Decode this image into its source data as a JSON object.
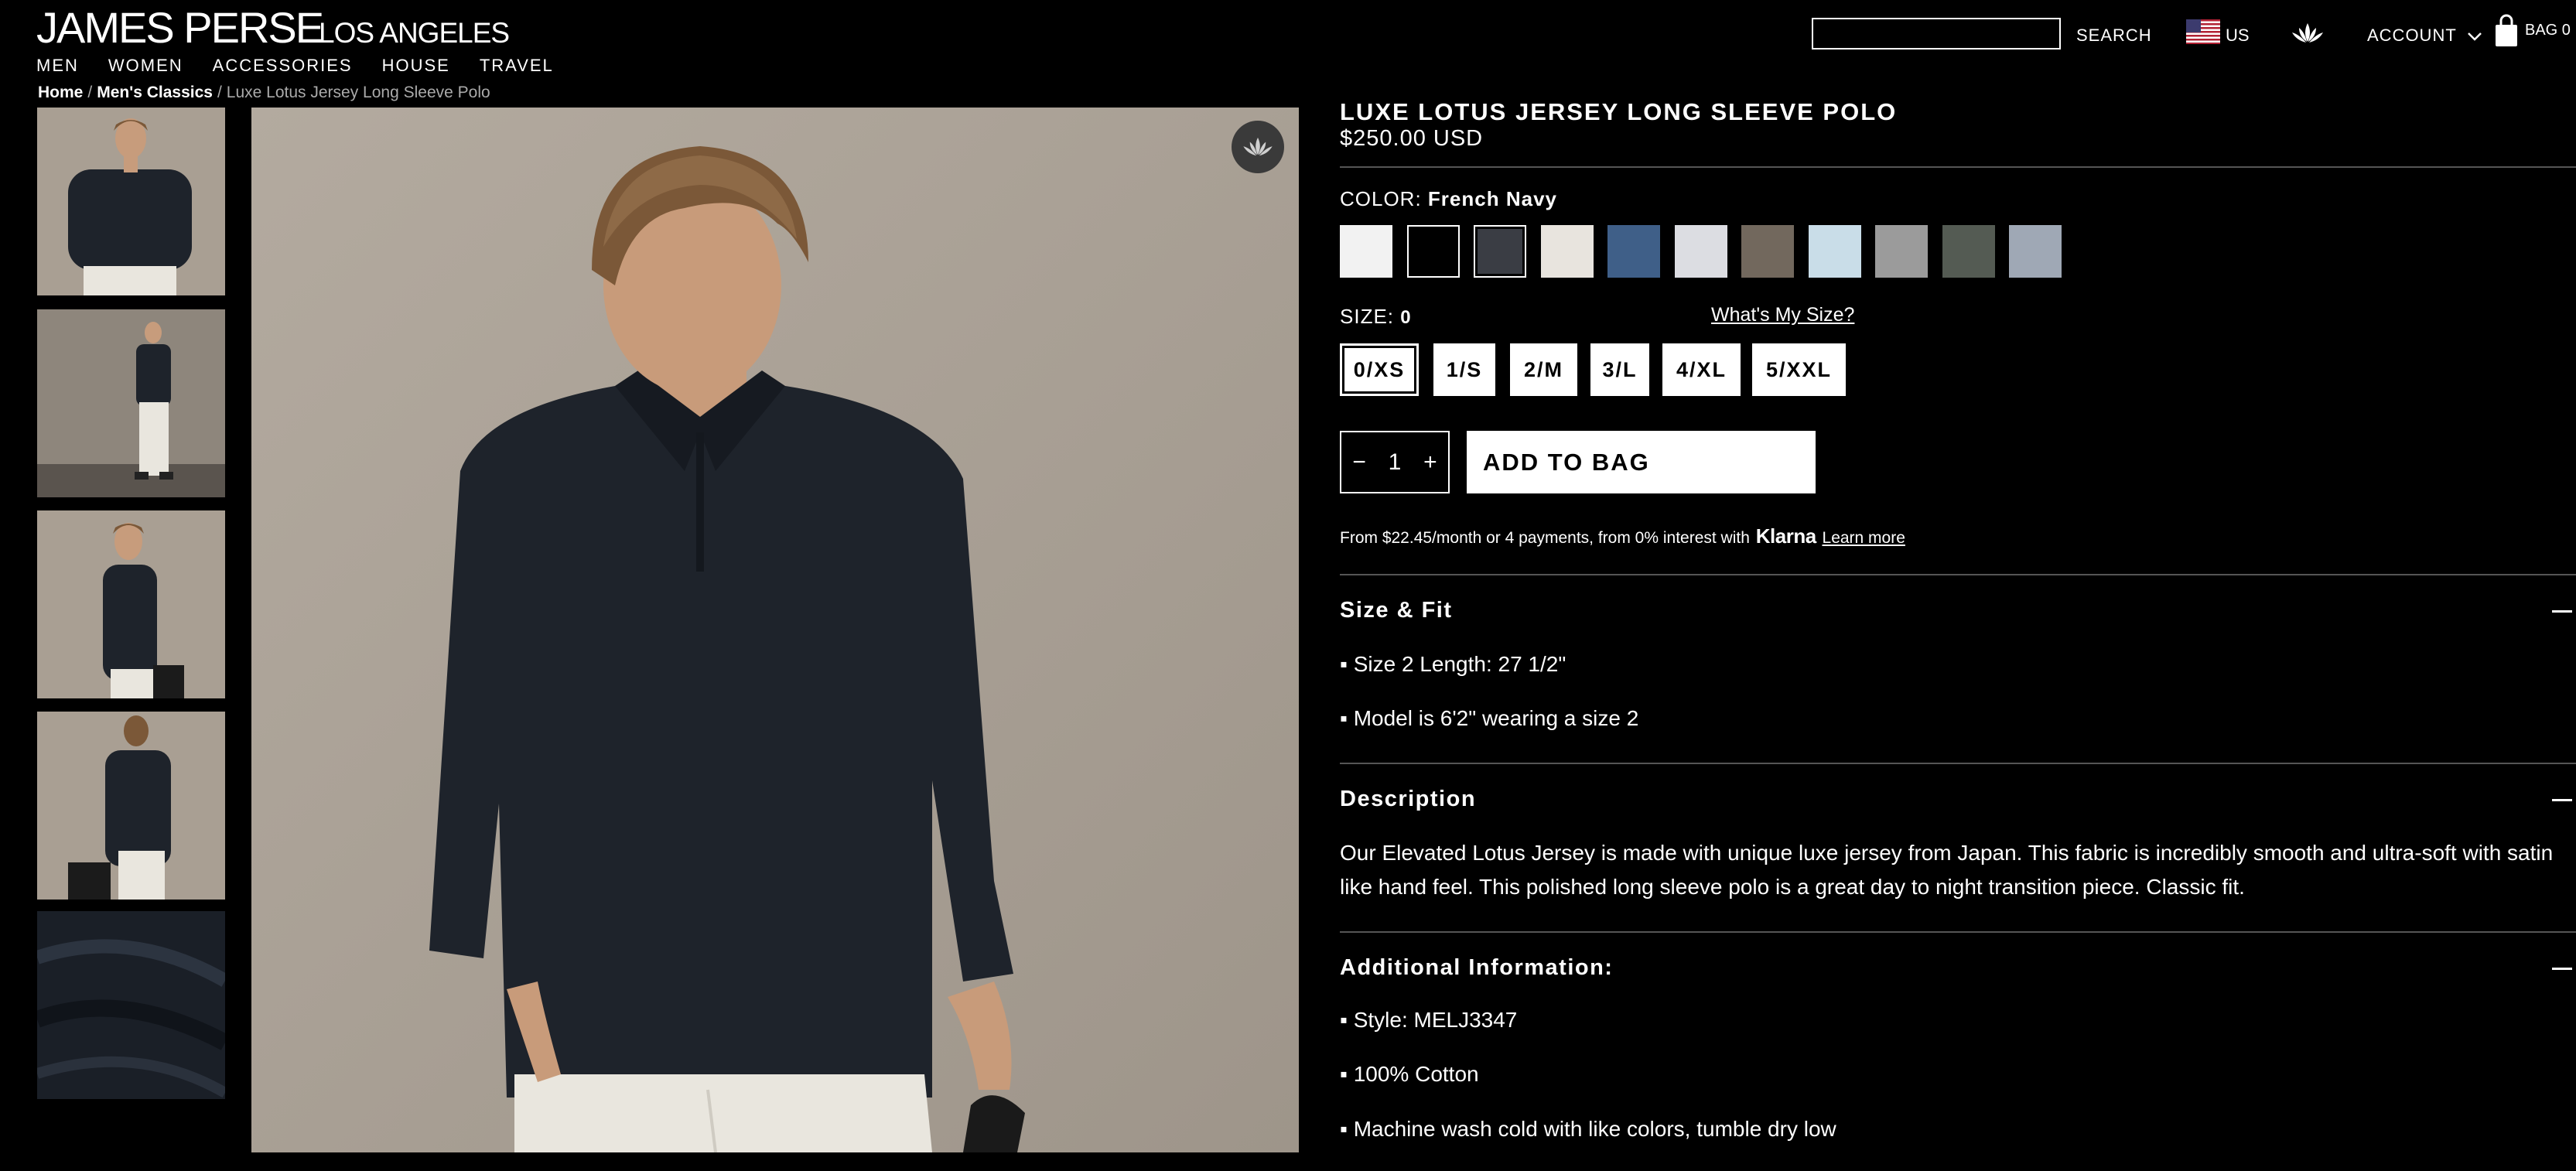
{
  "header": {
    "logo": "JAMES PERSE",
    "logo_sub": "LOS ANGELES",
    "nav": [
      "MEN",
      "WOMEN",
      "ACCESSORIES",
      "HOUSE",
      "TRAVEL"
    ],
    "search_value": "",
    "search_label": "SEARCH",
    "region": "US",
    "account": "ACCOUNT",
    "bag": "BAG 0"
  },
  "breadcrumb": {
    "home": "Home",
    "category": "Men's Classics",
    "current": "Luxe Lotus Jersey Long Sleeve Polo"
  },
  "product": {
    "title": "LUXE LOTUS JERSEY LONG SLEEVE POLO",
    "price": "$250.00 USD",
    "color_label": "COLOR:",
    "color_value": "French Navy",
    "swatches": [
      "#f2f2f2",
      "#000000",
      "#3a3d44",
      "#e8e4de",
      "#3f5f88",
      "#dcdde2",
      "#72685d",
      "#c9dde8",
      "#9b9b9b",
      "#545b53",
      "#9fa8b5"
    ],
    "size_label": "SIZE:",
    "size_value": "0",
    "fit_link": "What's My Size?",
    "sizes": [
      "0/XS",
      "1/S",
      "2/M",
      "3/L",
      "4/XL",
      "5/XXL"
    ],
    "qty_minus": "−",
    "qty": "1",
    "qty_plus": "+",
    "add_to_bag": "ADD TO BAG",
    "klarna_pre": "From $22.45/month or 4 payments, from 0% interest with",
    "klarna_brand": "Klarna",
    "klarna_link": "Learn more"
  },
  "accordion": {
    "size_fit": {
      "title": "Size & Fit",
      "items": [
        "▪ Size 2 Length: 27 1/2\"",
        "▪ Model is 6'2\" wearing a size 2"
      ]
    },
    "description": {
      "title": "Description",
      "text": "Our Elevated Lotus Jersey is made with unique luxe jersey from Japan. This fabric is incredibly smooth and ultra-soft with satin like hand feel. This polished long sleeve polo is a great day to night transition piece. Classic fit."
    },
    "additional": {
      "title": "Additional Information:",
      "items": [
        "▪ Style: MELJ3347",
        "▪ 100% Cotton",
        "▪ Machine wash cold with like colors, tumble dry low"
      ]
    }
  },
  "colors": {
    "background": "#000000",
    "text": "#ffffff",
    "photo_backdrop": "#a99f93",
    "shirt": "#1e232b",
    "pants": "#e9e6de"
  }
}
